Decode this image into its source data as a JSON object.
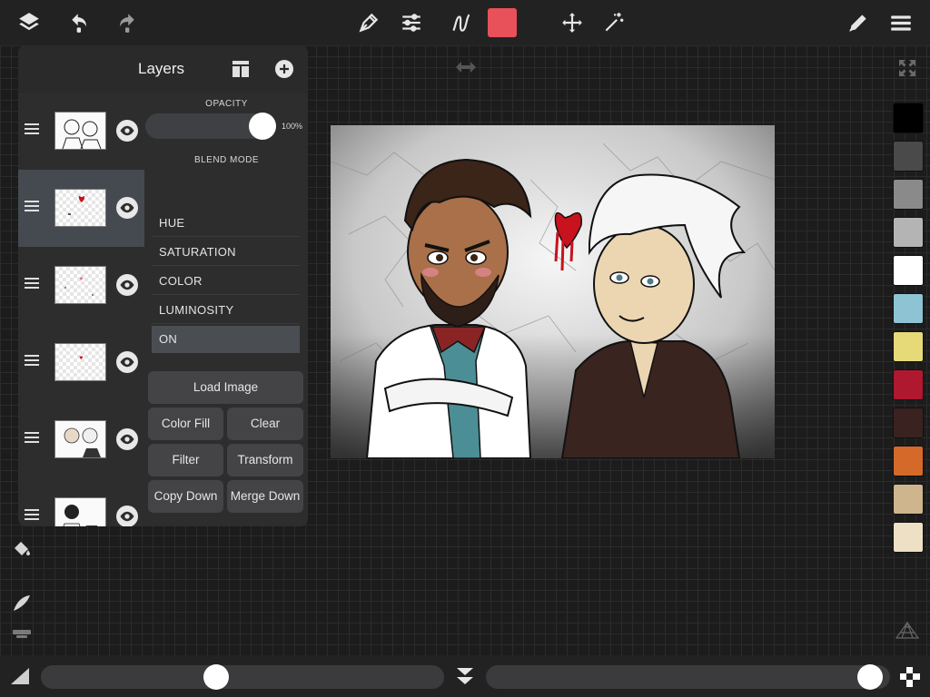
{
  "toolbar": {
    "icons": [
      "layers-icon",
      "undo-icon",
      "redo-icon",
      "pen-icon",
      "adjust-icon",
      "stroke-icon",
      "move-icon",
      "magic-wand-icon",
      "edit-icon",
      "menu-icon"
    ],
    "current_color": "#e8505a"
  },
  "layers_panel": {
    "title": "Layers",
    "layers": [
      {
        "name": "layer-1",
        "visible": true,
        "selected": false
      },
      {
        "name": "layer-2",
        "visible": true,
        "selected": true
      },
      {
        "name": "layer-3",
        "visible": true,
        "selected": false
      },
      {
        "name": "layer-4",
        "visible": true,
        "selected": false
      },
      {
        "name": "layer-5",
        "visible": true,
        "selected": false
      },
      {
        "name": "layer-6",
        "visible": true,
        "selected": false
      }
    ],
    "opacity_label": "OPACITY",
    "opacity_value": "100%",
    "opacity_fraction": 1.0,
    "blend_mode_label": "BLEND MODE",
    "blend_modes": [
      "HUE",
      "SATURATION",
      "COLOR",
      "LUMINOSITY",
      "ON"
    ],
    "selected_blend": "ON",
    "buttons": {
      "load_image": "Load Image",
      "color_fill": "Color Fill",
      "clear": "Clear",
      "filter": "Filter",
      "transform": "Transform",
      "copy_down": "Copy Down",
      "merge_down": "Merge Down"
    }
  },
  "palette": [
    "#000000",
    "#4a4a4a",
    "#8a8a8a",
    "#b4b4b4",
    "#ffffff",
    "#8ec3d3",
    "#e6da78",
    "#b01830",
    "#3a2220",
    "#d4692a",
    "#cfb58d",
    "#ede0c4"
  ],
  "bottom": {
    "brush_size_fraction": 0.43,
    "opacity_fraction": 0.98
  }
}
